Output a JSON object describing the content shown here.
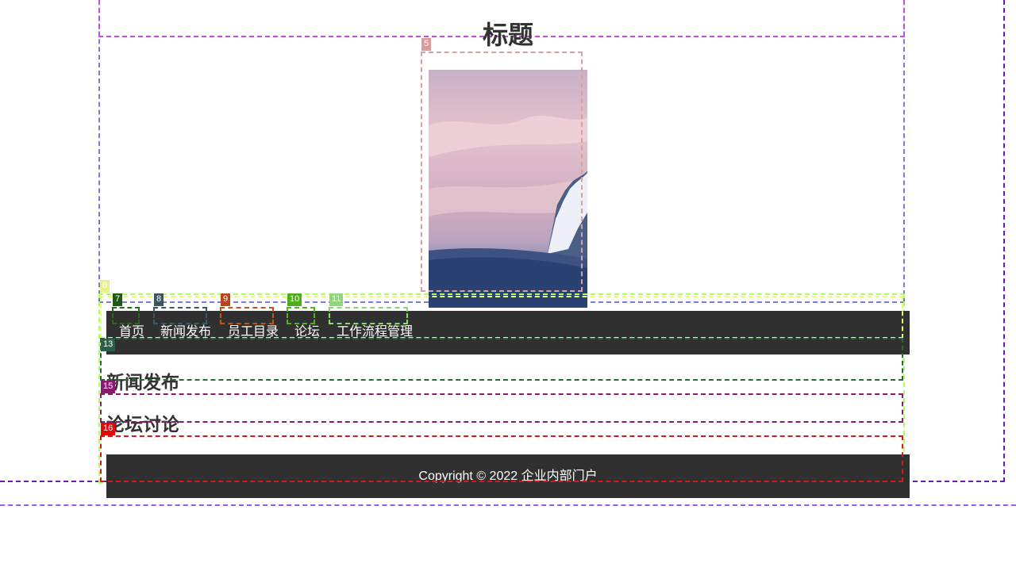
{
  "page": {
    "title": "标题"
  },
  "hero": {
    "alt": "雪山与晚霞"
  },
  "nav": {
    "items": [
      {
        "label": "首页"
      },
      {
        "label": "新闻发布"
      },
      {
        "label": "员工目录"
      },
      {
        "label": "论坛"
      },
      {
        "label": "工作流程管理"
      }
    ]
  },
  "sections": [
    {
      "title": "新闻发布"
    },
    {
      "title": "论坛讨论"
    }
  ],
  "footer": {
    "text": "Copyright © 2022 企业内部门户"
  },
  "debug_tags": [
    "5",
    "6",
    "7",
    "8",
    "9",
    "10",
    "11",
    "13",
    "15",
    "16"
  ],
  "colors": {
    "nav_bg": "#303030",
    "footer_bg": "#303030",
    "text": "#333333",
    "nav_text": "#ffffff"
  }
}
